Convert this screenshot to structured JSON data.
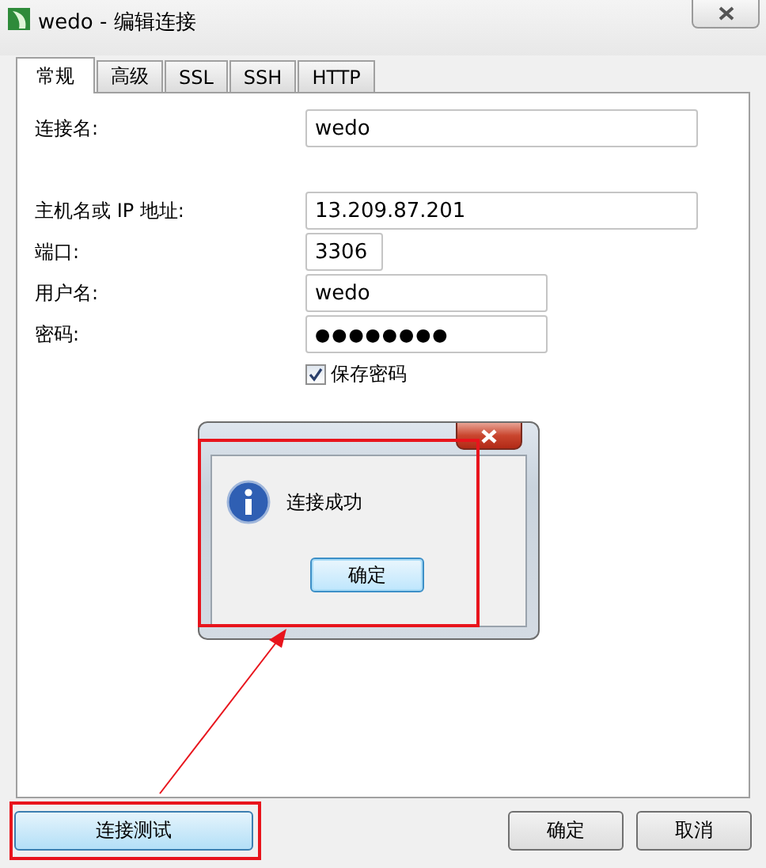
{
  "window": {
    "title": "wedo - 编辑连接"
  },
  "tabs": [
    {
      "label": "常规",
      "selected": true
    },
    {
      "label": "高级",
      "selected": false
    },
    {
      "label": "SSL",
      "selected": false
    },
    {
      "label": "SSH",
      "selected": false
    },
    {
      "label": "HTTP",
      "selected": false
    }
  ],
  "fields": [
    {
      "label": "连接名:",
      "value": "wedo",
      "kind": "wide"
    },
    {
      "label": "主机名或 IP 地址:",
      "value": "13.209.87.201",
      "kind": "wide"
    },
    {
      "label": "端口:",
      "value": "3306",
      "kind": "short"
    },
    {
      "label": "用户名:",
      "value": "wedo",
      "kind": "medium"
    },
    {
      "label": "密码:",
      "value": "●●●●●●●●",
      "kind": "password"
    }
  ],
  "save_password": {
    "label": "保存密码",
    "checked": true
  },
  "message_box": {
    "message": "连接成功",
    "button": "确定"
  },
  "buttons": [
    "连接测试",
    "确定",
    "取消"
  ]
}
